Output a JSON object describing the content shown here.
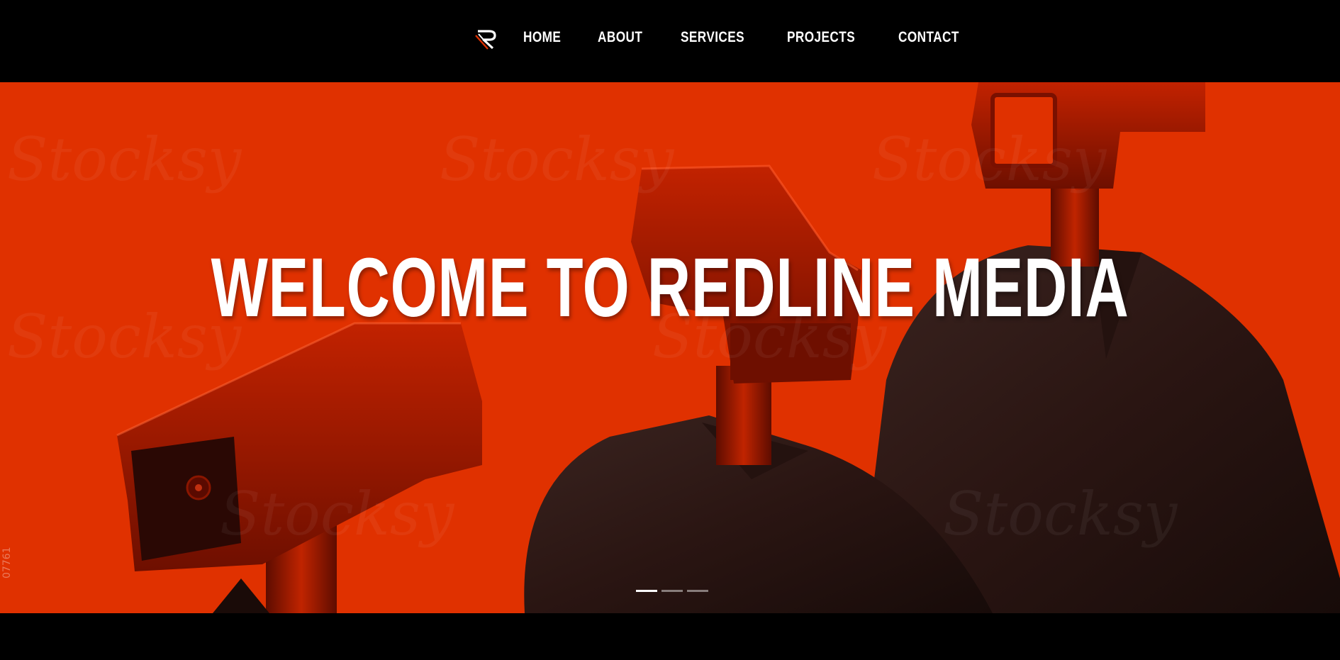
{
  "header": {
    "logo_icon": "redline-r-logo-icon",
    "nav": [
      {
        "label": "HOME"
      },
      {
        "label": "ABOUT"
      },
      {
        "label": "SERVICES"
      },
      {
        "label": "PROJECTS"
      },
      {
        "label": "CONTACT"
      }
    ]
  },
  "hero": {
    "headline": "WELCOME TO REDLINE MEDIA",
    "watermark": "Stocksy",
    "side_code": "07761",
    "slider": {
      "count": 3,
      "active_index": 0
    },
    "background_color": "#e03100"
  }
}
